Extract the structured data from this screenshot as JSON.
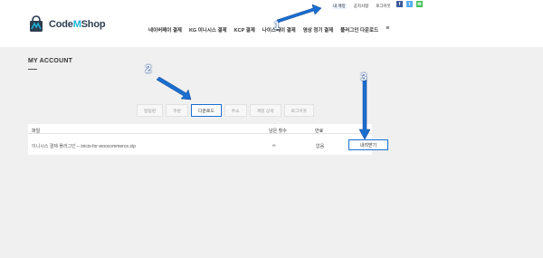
{
  "brand": {
    "name_prefix": "Code",
    "name_highlight": "M",
    "name_suffix": "Shop"
  },
  "top_links": [
    {
      "label": "내 계정",
      "active": true
    },
    {
      "label": "공지사항",
      "active": false
    },
    {
      "label": "로그아웃",
      "active": false
    }
  ],
  "social": [
    {
      "icon": "facebook-icon",
      "glyph": "f"
    },
    {
      "icon": "twitter-icon",
      "glyph": "t"
    },
    {
      "icon": "sms-icon",
      "glyph": "✉"
    }
  ],
  "nav": [
    "네이버페이 결제",
    "KG 이니시스 결제",
    "KCP 결제",
    "나이스페이 결제",
    "영상 정기 결제",
    "플러그인 다운로드"
  ],
  "nav_menu_glyph": "≡",
  "page_title": "MY ACCOUNT",
  "tabs": [
    {
      "label": "알림판",
      "active": false
    },
    {
      "label": "주문",
      "active": false
    },
    {
      "label": "다운로드",
      "active": true
    },
    {
      "label": "주소",
      "active": false
    },
    {
      "label": "계정 상세",
      "active": false
    },
    {
      "label": "로그아웃",
      "active": false
    }
  ],
  "table": {
    "headers": {
      "file": "파일",
      "remaining": "남은 횟수",
      "expires": "만료"
    },
    "row": {
      "file": "이니시스 결제 플러그인 – inicis-for-woocommerce.zip",
      "remaining": "∞",
      "expires": "없음",
      "action": "내려받기"
    }
  },
  "annotations": [
    "1",
    "2",
    "3"
  ],
  "colors": {
    "accent": "#1a6fd1",
    "brand_dark": "#2d3e50",
    "brand_m": "#1bb4d8"
  }
}
